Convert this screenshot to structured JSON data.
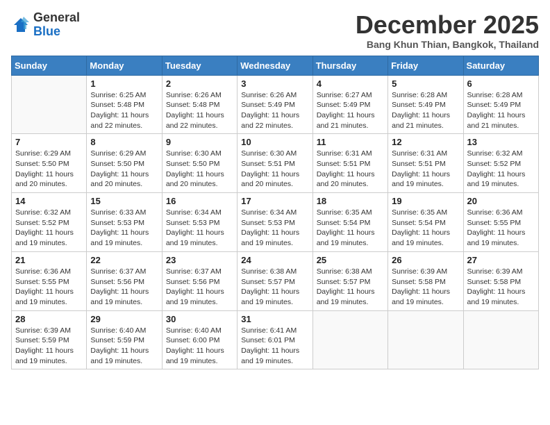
{
  "header": {
    "logo_general": "General",
    "logo_blue": "Blue",
    "month_title": "December 2025",
    "location": "Bang Khun Thian, Bangkok, Thailand"
  },
  "weekdays": [
    "Sunday",
    "Monday",
    "Tuesday",
    "Wednesday",
    "Thursday",
    "Friday",
    "Saturday"
  ],
  "weeks": [
    [
      {
        "day": "",
        "info": ""
      },
      {
        "day": "1",
        "info": "Sunrise: 6:25 AM\nSunset: 5:48 PM\nDaylight: 11 hours\nand 22 minutes."
      },
      {
        "day": "2",
        "info": "Sunrise: 6:26 AM\nSunset: 5:48 PM\nDaylight: 11 hours\nand 22 minutes."
      },
      {
        "day": "3",
        "info": "Sunrise: 6:26 AM\nSunset: 5:49 PM\nDaylight: 11 hours\nand 22 minutes."
      },
      {
        "day": "4",
        "info": "Sunrise: 6:27 AM\nSunset: 5:49 PM\nDaylight: 11 hours\nand 21 minutes."
      },
      {
        "day": "5",
        "info": "Sunrise: 6:28 AM\nSunset: 5:49 PM\nDaylight: 11 hours\nand 21 minutes."
      },
      {
        "day": "6",
        "info": "Sunrise: 6:28 AM\nSunset: 5:49 PM\nDaylight: 11 hours\nand 21 minutes."
      }
    ],
    [
      {
        "day": "7",
        "info": "Sunrise: 6:29 AM\nSunset: 5:50 PM\nDaylight: 11 hours\nand 20 minutes."
      },
      {
        "day": "8",
        "info": "Sunrise: 6:29 AM\nSunset: 5:50 PM\nDaylight: 11 hours\nand 20 minutes."
      },
      {
        "day": "9",
        "info": "Sunrise: 6:30 AM\nSunset: 5:50 PM\nDaylight: 11 hours\nand 20 minutes."
      },
      {
        "day": "10",
        "info": "Sunrise: 6:30 AM\nSunset: 5:51 PM\nDaylight: 11 hours\nand 20 minutes."
      },
      {
        "day": "11",
        "info": "Sunrise: 6:31 AM\nSunset: 5:51 PM\nDaylight: 11 hours\nand 20 minutes."
      },
      {
        "day": "12",
        "info": "Sunrise: 6:31 AM\nSunset: 5:51 PM\nDaylight: 11 hours\nand 19 minutes."
      },
      {
        "day": "13",
        "info": "Sunrise: 6:32 AM\nSunset: 5:52 PM\nDaylight: 11 hours\nand 19 minutes."
      }
    ],
    [
      {
        "day": "14",
        "info": "Sunrise: 6:32 AM\nSunset: 5:52 PM\nDaylight: 11 hours\nand 19 minutes."
      },
      {
        "day": "15",
        "info": "Sunrise: 6:33 AM\nSunset: 5:53 PM\nDaylight: 11 hours\nand 19 minutes."
      },
      {
        "day": "16",
        "info": "Sunrise: 6:34 AM\nSunset: 5:53 PM\nDaylight: 11 hours\nand 19 minutes."
      },
      {
        "day": "17",
        "info": "Sunrise: 6:34 AM\nSunset: 5:53 PM\nDaylight: 11 hours\nand 19 minutes."
      },
      {
        "day": "18",
        "info": "Sunrise: 6:35 AM\nSunset: 5:54 PM\nDaylight: 11 hours\nand 19 minutes."
      },
      {
        "day": "19",
        "info": "Sunrise: 6:35 AM\nSunset: 5:54 PM\nDaylight: 11 hours\nand 19 minutes."
      },
      {
        "day": "20",
        "info": "Sunrise: 6:36 AM\nSunset: 5:55 PM\nDaylight: 11 hours\nand 19 minutes."
      }
    ],
    [
      {
        "day": "21",
        "info": "Sunrise: 6:36 AM\nSunset: 5:55 PM\nDaylight: 11 hours\nand 19 minutes."
      },
      {
        "day": "22",
        "info": "Sunrise: 6:37 AM\nSunset: 5:56 PM\nDaylight: 11 hours\nand 19 minutes."
      },
      {
        "day": "23",
        "info": "Sunrise: 6:37 AM\nSunset: 5:56 PM\nDaylight: 11 hours\nand 19 minutes."
      },
      {
        "day": "24",
        "info": "Sunrise: 6:38 AM\nSunset: 5:57 PM\nDaylight: 11 hours\nand 19 minutes."
      },
      {
        "day": "25",
        "info": "Sunrise: 6:38 AM\nSunset: 5:57 PM\nDaylight: 11 hours\nand 19 minutes."
      },
      {
        "day": "26",
        "info": "Sunrise: 6:39 AM\nSunset: 5:58 PM\nDaylight: 11 hours\nand 19 minutes."
      },
      {
        "day": "27",
        "info": "Sunrise: 6:39 AM\nSunset: 5:58 PM\nDaylight: 11 hours\nand 19 minutes."
      }
    ],
    [
      {
        "day": "28",
        "info": "Sunrise: 6:39 AM\nSunset: 5:59 PM\nDaylight: 11 hours\nand 19 minutes."
      },
      {
        "day": "29",
        "info": "Sunrise: 6:40 AM\nSunset: 5:59 PM\nDaylight: 11 hours\nand 19 minutes."
      },
      {
        "day": "30",
        "info": "Sunrise: 6:40 AM\nSunset: 6:00 PM\nDaylight: 11 hours\nand 19 minutes."
      },
      {
        "day": "31",
        "info": "Sunrise: 6:41 AM\nSunset: 6:01 PM\nDaylight: 11 hours\nand 19 minutes."
      },
      {
        "day": "",
        "info": ""
      },
      {
        "day": "",
        "info": ""
      },
      {
        "day": "",
        "info": ""
      }
    ]
  ]
}
